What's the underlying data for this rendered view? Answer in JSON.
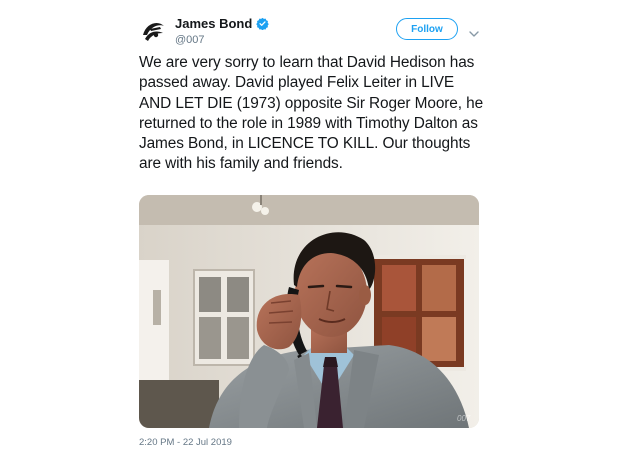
{
  "tweet": {
    "author": {
      "display_name": "James Bond",
      "handle": "@007",
      "verified": true,
      "avatar_icon": "007-gun-logo-icon"
    },
    "follow_label": "Follow",
    "text": "We are very sorry to learn that David Hedison has passed away. David played Felix Leiter in LIVE AND LET DIE (1973) opposite Sir Roger Moore, he returned to the role in 1989 with Timothy Dalton as James Bond, in LICENCE TO KILL. Our thoughts are with his family and friends.",
    "photo": {
      "watermark": "007"
    },
    "timestamp": "2:20 PM - 22 Jul 2019"
  },
  "colors": {
    "accent": "#1da1f2",
    "text_primary": "#14171a",
    "text_secondary": "#657786"
  }
}
